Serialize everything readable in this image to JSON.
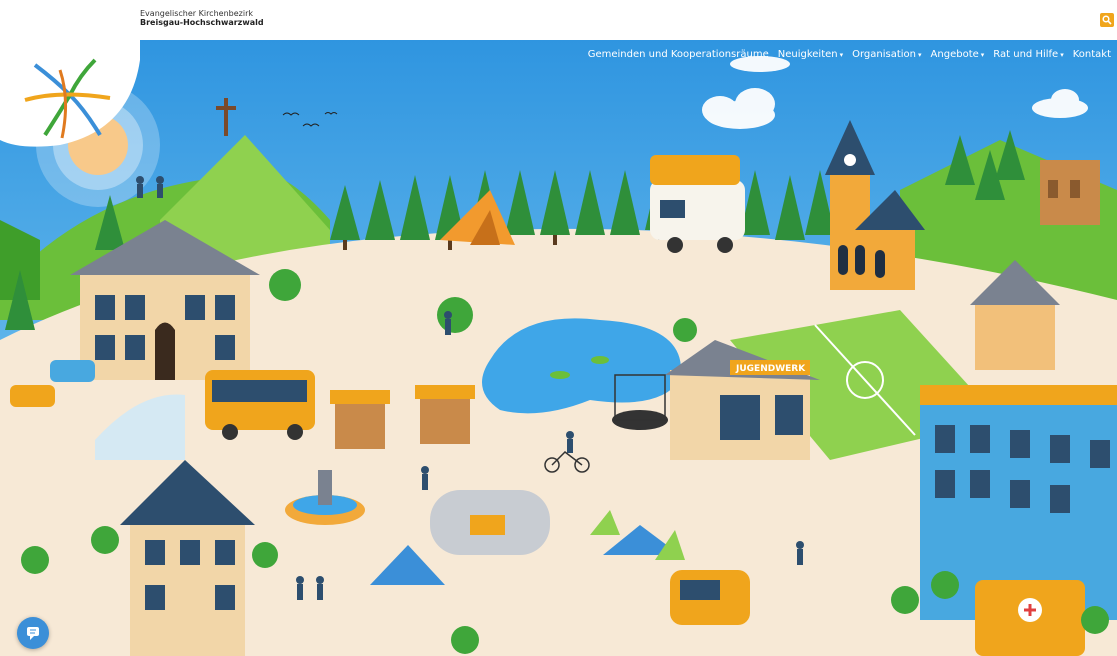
{
  "header": {
    "org_name_line1": "Evangelischer Kirchenbezirk",
    "org_name_line2": "Breisgau-Hochschwarzwald"
  },
  "nav": {
    "items": [
      {
        "label": "Gemeinden und Kooperationsräume",
        "has_dropdown": false
      },
      {
        "label": "Neuigkeiten",
        "has_dropdown": true
      },
      {
        "label": "Organisation",
        "has_dropdown": true
      },
      {
        "label": "Angebote",
        "has_dropdown": true
      },
      {
        "label": "Rat und Hilfe",
        "has_dropdown": true
      },
      {
        "label": "Kontakt",
        "has_dropdown": false
      }
    ],
    "dropdown_caret": "▾"
  },
  "hero": {
    "sign_text": "JUGENDWERK"
  },
  "icons": {
    "search": "search-icon",
    "chat": "chat-icon"
  },
  "colors": {
    "sky": "#3fa6e8",
    "search_button": "#f0a51c",
    "chat_button": "#3b8fd8",
    "grass": "#8fd14f",
    "ground": "#f7e9d6"
  }
}
